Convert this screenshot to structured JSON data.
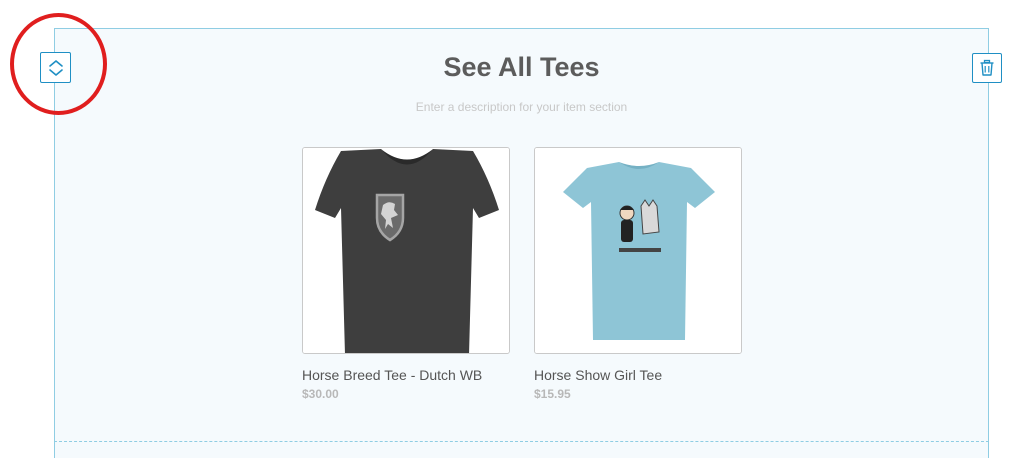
{
  "section": {
    "title": "See All Tees",
    "description_placeholder": "Enter a description for your item section"
  },
  "toolbar": {
    "collapse_icon": "collapse-toggle-icon",
    "delete_icon": "trash-icon"
  },
  "items": [
    {
      "name": "Horse Breed Tee - Dutch WB",
      "price": "$30.00",
      "image": "dark-gray-v-neck-tee-with-lion-crest"
    },
    {
      "name": "Horse Show Girl Tee",
      "price": "$15.95",
      "image": "light-blue-tee-girl-and-horse-cartoon"
    }
  ],
  "colors": {
    "accent": "#1f8fc4",
    "border": "#8fcde3",
    "annotation": "#e01e1e"
  }
}
